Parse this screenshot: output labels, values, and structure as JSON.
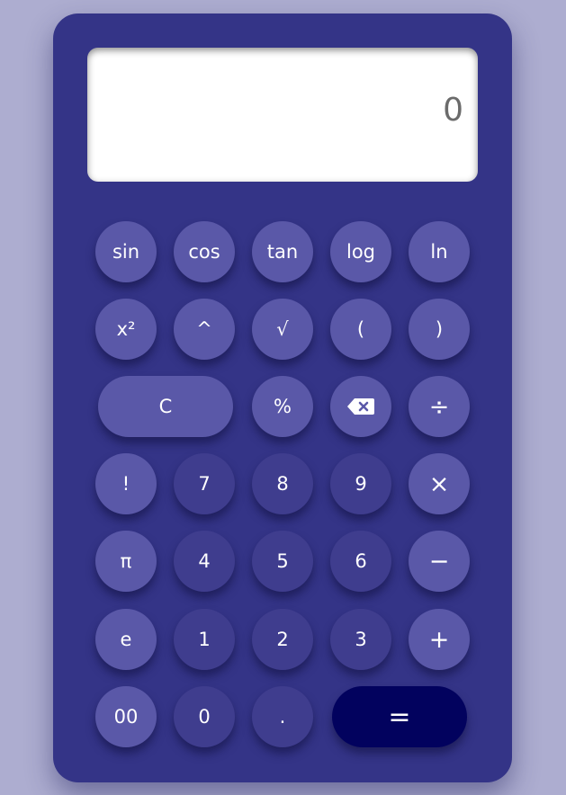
{
  "display": {
    "value": "0"
  },
  "keys": {
    "sin": "sin",
    "cos": "cos",
    "tan": "tan",
    "log": "log",
    "ln": "ln",
    "square": "x²",
    "power": "^",
    "sqrt": "√",
    "open_paren": "(",
    "close_paren": ")",
    "clear": "C",
    "percent": "%",
    "backspace_icon": "backspace-icon",
    "divide": "÷",
    "factorial": "!",
    "seven": "7",
    "eight": "8",
    "nine": "9",
    "multiply": "×",
    "pi": "π",
    "four": "4",
    "five": "5",
    "six": "6",
    "minus": "−",
    "e": "e",
    "one": "1",
    "two": "2",
    "three": "3",
    "plus": "+",
    "double_zero": "00",
    "zero": "0",
    "decimal": ".",
    "equals": "="
  },
  "colors": {
    "page_background": "#adadd0",
    "body": "#343487",
    "function_key": "#5a58a8",
    "digit_key": "#3f3d8e",
    "equals_key": "#02025e",
    "display_text": "#6b6b6b"
  }
}
